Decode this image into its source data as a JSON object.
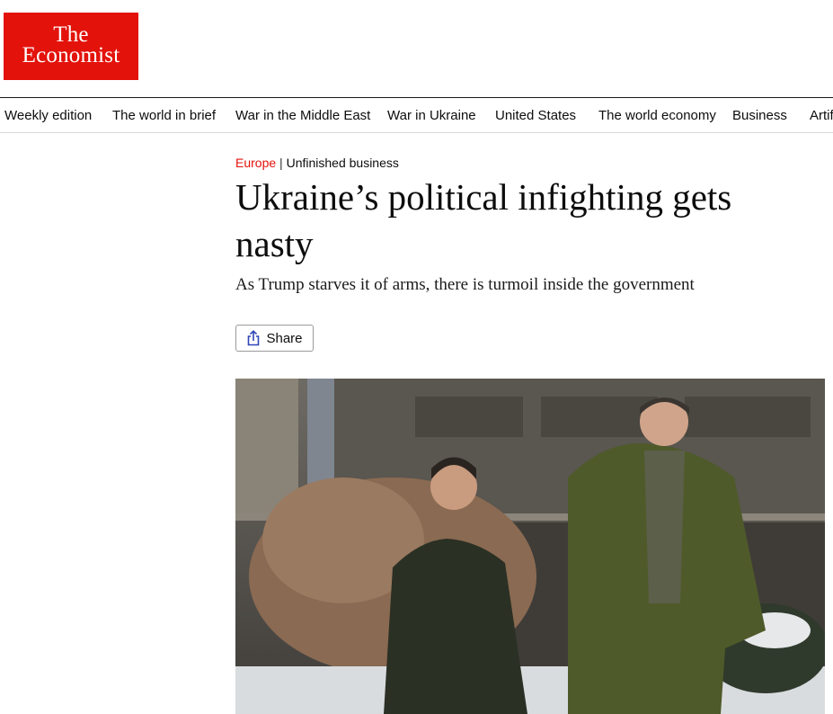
{
  "logo": {
    "line1": "The",
    "line2": "Economist"
  },
  "nav": {
    "items": [
      "Weekly edition",
      "The world in brief",
      "War in the Middle East",
      "War in Ukraine",
      "United States",
      "The world economy",
      "Business",
      "Artificial intelligence"
    ]
  },
  "article": {
    "section": "Europe",
    "separator": "|",
    "rubric": "Unfinished business",
    "headline": "Ukraine’s political infighting gets nasty",
    "subhead": "As Trump starves it of arms, there is turmoil inside the government",
    "share_label": "Share"
  },
  "colors": {
    "brand_red": "#e3120b",
    "text": "#0d0d0d"
  },
  "icons": {
    "share": "share-icon"
  }
}
